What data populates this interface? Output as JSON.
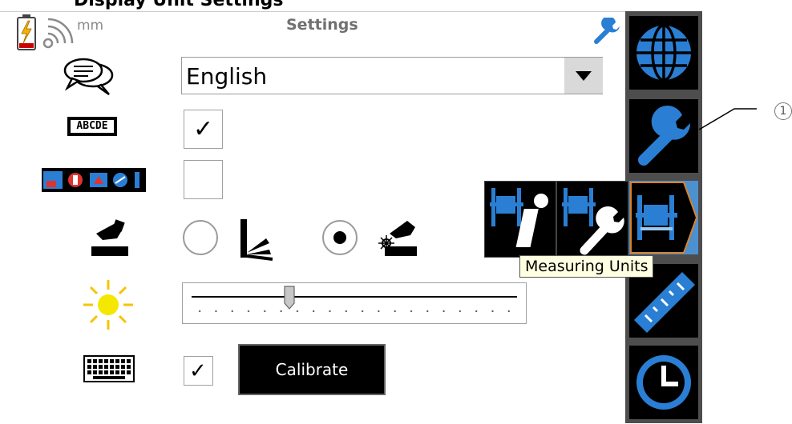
{
  "doc_title": "Display Unit Settings",
  "status": {
    "unit": "mm",
    "icons": [
      "battery-charging-icon",
      "wireless-signal-icon"
    ]
  },
  "header": {
    "title": "Settings",
    "active_icon": "wrench-icon"
  },
  "settings": {
    "language": {
      "icon": "speech-bubbles-icon",
      "value": "English"
    },
    "abcde": {
      "icon": "abcde-text-icon",
      "label": "ABCDE",
      "checked": true
    },
    "step_icons": {
      "icon": "step-icons-strip-icon",
      "checked": false
    },
    "sensor_mode": {
      "icon": "laser-sensor-icon",
      "options": [
        "fan-beam-icon",
        "laser-spot-icon"
      ],
      "selected": 1
    },
    "brightness": {
      "icon": "sun-icon",
      "level": 0.3
    },
    "keyboard": {
      "icon": "keyboard-icon",
      "checked": true,
      "calibrate_label": "Calibrate"
    }
  },
  "sidebar": {
    "items": [
      "globe-icon",
      "wrench-icon",
      "machine-measure-icon",
      "ruler-icon",
      "clock-icon"
    ],
    "flyout": [
      "machine-info-icon",
      "machine-wrench-icon"
    ],
    "tooltip": "Measuring Units"
  },
  "callout": "1",
  "colors": {
    "accent_blue": "#2a7fd4",
    "selected_orange": "#d9822b",
    "panel_gray": "#4d4d4d"
  }
}
